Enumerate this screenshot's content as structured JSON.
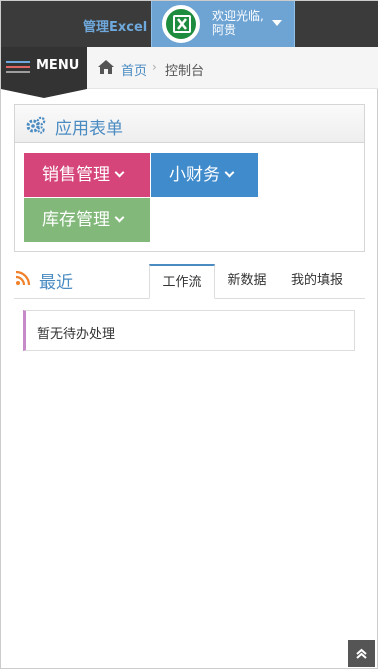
{
  "navbar": {
    "brand": "管理Excel",
    "welcome_line1": "欢迎光临,",
    "welcome_line2": "阿贵"
  },
  "breadcrumb": {
    "menu_label": "MENU",
    "home": "首页",
    "separator": "›",
    "current": "控制台"
  },
  "apps_panel": {
    "title": "应用表单",
    "tiles": [
      {
        "label": "销售管理",
        "color": "#d6457a"
      },
      {
        "label": "小财务",
        "color": "#3f8bcc"
      },
      {
        "label": "库存管理",
        "color": "#82b97b"
      }
    ]
  },
  "recent": {
    "title": "最近",
    "tabs": [
      "工作流",
      "新数据",
      "我的填报"
    ],
    "active_tab": "工作流",
    "empty_message": "暂无待办处理"
  },
  "colors": {
    "navbar_bg": "#3b3b3b",
    "user_box_bg": "#6ea4d4",
    "accent": "#4a8bc2",
    "rss": "#f0812a"
  },
  "icons": {
    "avatar": "excel-icon",
    "home": "home-icon",
    "apps": "gears-icon",
    "recent": "rss-icon",
    "scroll": "double-chevron-up-icon"
  }
}
